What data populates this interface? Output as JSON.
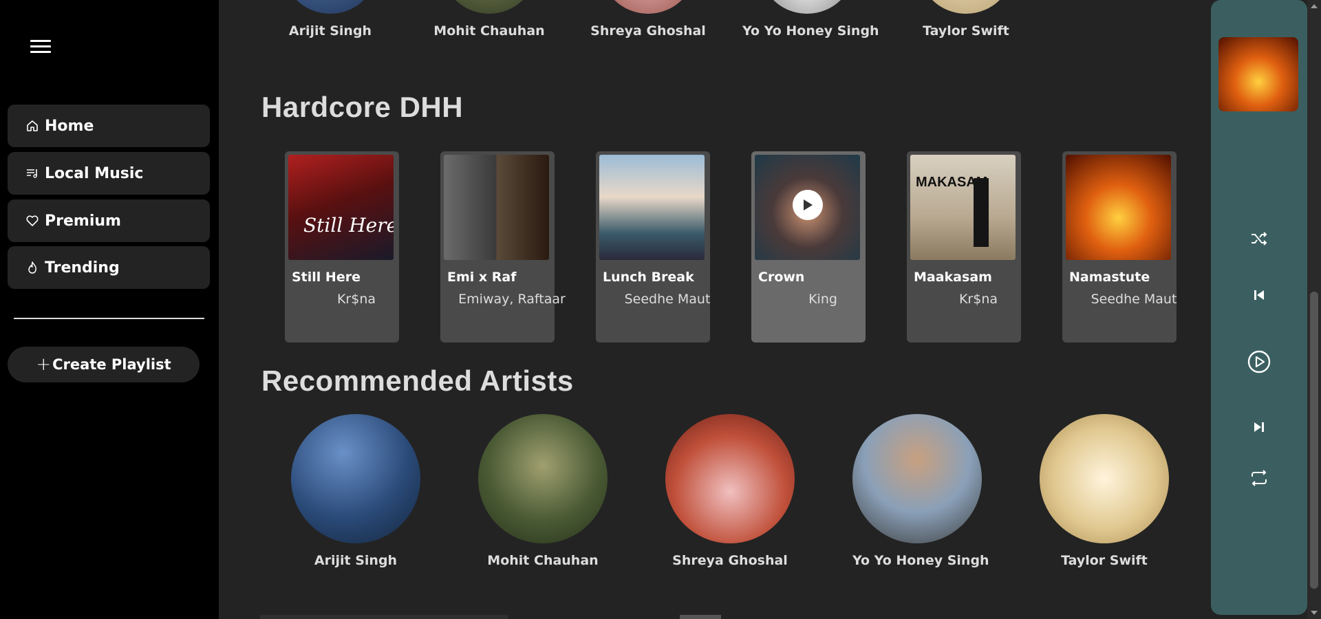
{
  "sidebar": {
    "nav": [
      {
        "label": "Home",
        "icon": "home-icon"
      },
      {
        "label": "Local Music",
        "icon": "music-list-icon"
      },
      {
        "label": "Premium",
        "icon": "heart-icon"
      },
      {
        "label": "Trending",
        "icon": "flame-icon"
      }
    ],
    "create_playlist": "Create Playlist"
  },
  "top_artists": [
    "Arijit Singh",
    "Mohit Chauhan",
    "Shreya Ghoshal",
    "Yo Yo Honey Singh",
    "Taylor Swift"
  ],
  "hardcore": {
    "title": "Hardcore DHH",
    "cards": [
      {
        "song": "Still Here",
        "artist": "Kr$na"
      },
      {
        "song": "Emi x Raf",
        "artist": "Emiway, Raftaar"
      },
      {
        "song": "Lunch Break",
        "artist": "Seedhe Maut"
      },
      {
        "song": "Crown",
        "artist": "King"
      },
      {
        "song": "Maakasam",
        "artist": "Kr$na"
      },
      {
        "song": "Namastute",
        "artist": "Seedhe Maut"
      }
    ]
  },
  "recommended": {
    "title": "Recommended Artists",
    "artists": [
      "Arijit Singh",
      "Mohit Chauhan",
      "Shreya Ghoshal",
      "Yo Yo Honey Singh",
      "Taylor Swift"
    ]
  },
  "player": {
    "shuffle": "shuffle-icon",
    "prev": "skip-back-icon",
    "play": "play-icon",
    "next": "skip-forward-icon",
    "repeat": "repeat-icon"
  },
  "colors": {
    "sidebar_bg": "#000000",
    "main_bg": "#232323",
    "player_bg": "#3b5f60",
    "card_bg": "#4a4a4a"
  }
}
